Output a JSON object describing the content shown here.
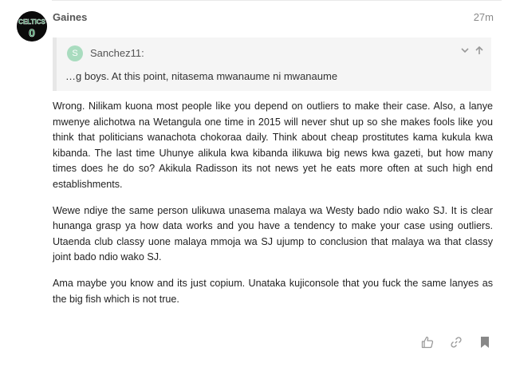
{
  "post": {
    "username": "Gaines",
    "date": "27m",
    "avatar": {
      "icon": "celtics-logo-icon",
      "text": "CELTICS",
      "number": "0",
      "accent": "#1f8a4c"
    }
  },
  "quote": {
    "avatar_letter": "S",
    "avatar_color": "#a9dcbf",
    "username": "Sanchez11:",
    "text": "…g boys. At this point, nitasema mwanaume ni mwanaume"
  },
  "paragraphs": [
    "Wrong. Nilikam kuona most people like you depend on outliers to make their case. Also, a lanye mwenye alichotwa na Wetangula one time in 2015 will never shut up so she makes fools like you think that politicians wanachota chokoraa daily. Think about cheap prostitutes kama kukula kwa kibanda. The last time Uhunye alikula kwa kibanda ilikuwa big news kwa gazeti, but how many times does he do so? Akikula Radisson its not news yet he eats more often at such high end establishments.",
    "Wewe ndiye the same person ulikuwa unasema malaya wa Westy bado ndio wako SJ. It is clear hunanga grasp ya how data works and you have a tendency to make your case using outliers. Utaenda club classy uone malaya mmoja wa SJ ujump to conclusion that malaya wa that classy joint bado ndio wako SJ.",
    "Ama maybe you know and its just copium. Unataka kujiconsole that you fuck the same lanyes as the big fish which is not true."
  ],
  "actions": [
    {
      "name": "like-button",
      "icon": "thumbs-up-icon"
    },
    {
      "name": "share-link-button",
      "icon": "link-icon"
    },
    {
      "name": "bookmark-button",
      "icon": "bookmark-icon"
    }
  ]
}
